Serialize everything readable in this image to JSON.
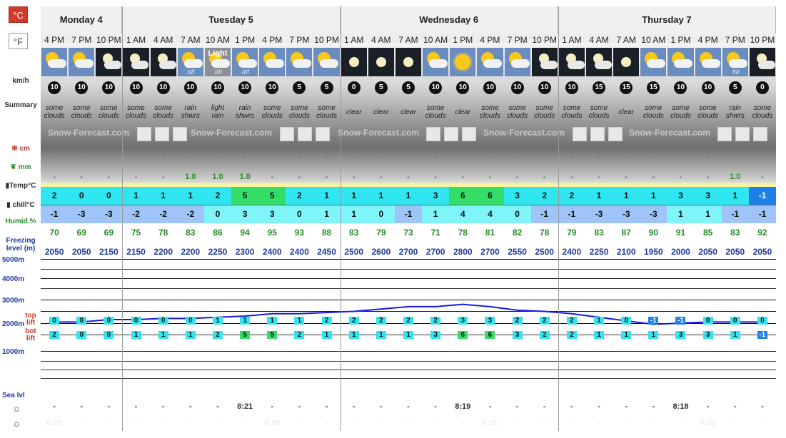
{
  "units": {
    "celsius": "°C",
    "fahrenheit": "°F"
  },
  "labels": {
    "wind": "km/h",
    "summary": "Summary",
    "snow": "cm",
    "rain": "mm",
    "temp": "Temp°C",
    "chill": "chill°C",
    "humid": "Humid.%",
    "freezing1": "Freezing",
    "freezing2": "level (m)",
    "top_lift1": "top",
    "top_lift2": "lift",
    "bot_lift1": "bot",
    "bot_lift2": "lift",
    "sea": "Sea lvl",
    "alt5000": "5000m",
    "alt4000": "4000m",
    "alt3000": "3000m",
    "alt2000": "2000m",
    "alt1000": "1000m"
  },
  "watermark": "Snow-Forecast.com",
  "days": [
    {
      "name": "Monday 4",
      "span": 3
    },
    {
      "name": "Tuesday 5",
      "span": 8
    },
    {
      "name": "Wednesday 6",
      "span": 8
    },
    {
      "name": "Thursday 7",
      "span": 8
    }
  ],
  "times": [
    "4 PM",
    "7 PM",
    "10 PM",
    "1 AM",
    "4 AM",
    "7 AM",
    "10 AM",
    "1 PM",
    "4 PM",
    "7 PM",
    "10 PM",
    "1 AM",
    "4 AM",
    "7 AM",
    "10 AM",
    "1 PM",
    "4 PM",
    "7 PM",
    "10 PM",
    "1 AM",
    "4 AM",
    "7 AM",
    "10 AM",
    "1 PM",
    "4 PM",
    "7 PM",
    "10 PM"
  ],
  "icons": [
    "partly-cloudy-icon",
    "partly-cloudy-icon",
    "cloudy-night-icon",
    "cloudy-night-icon",
    "cloudy-night-icon",
    "rain-showers-icon",
    "light-rain-icon",
    "rain-showers-icon",
    "partly-cloudy-icon",
    "partly-cloudy-icon",
    "partly-cloudy-icon",
    "clear-night-icon",
    "clear-night-icon",
    "clear-night-icon",
    "partly-cloudy-icon",
    "sunny-icon",
    "partly-cloudy-icon",
    "partly-cloudy-icon",
    "cloudy-night-icon",
    "cloudy-night-icon",
    "cloudy-night-icon",
    "clear-night-icon",
    "partly-cloudy-icon",
    "partly-cloudy-icon",
    "partly-cloudy-icon",
    "rain-showers-icon",
    "cloudy-night-icon"
  ],
  "icon_label_light": "Light",
  "wind": [
    "10",
    "10",
    "10",
    "10",
    "10",
    "10",
    "10",
    "10",
    "10",
    "5",
    "5",
    "0",
    "5",
    "5",
    "10",
    "10",
    "10",
    "10",
    "10",
    "10",
    "15",
    "15",
    "15",
    "10",
    "10",
    "5",
    "0"
  ],
  "summary": [
    [
      "some",
      "clouds"
    ],
    [
      "some",
      "clouds"
    ],
    [
      "some",
      "clouds"
    ],
    [
      "some",
      "clouds"
    ],
    [
      "some",
      "clouds"
    ],
    [
      "rain",
      "shwrs"
    ],
    [
      "light",
      "rain"
    ],
    [
      "rain",
      "shwrs"
    ],
    [
      "some",
      "clouds"
    ],
    [
      "some",
      "clouds"
    ],
    [
      "some",
      "clouds"
    ],
    [
      "clear",
      ""
    ],
    [
      "clear",
      ""
    ],
    [
      "clear",
      ""
    ],
    [
      "some",
      "clouds"
    ],
    [
      "clear",
      ""
    ],
    [
      "some",
      "clouds"
    ],
    [
      "some",
      "clouds"
    ],
    [
      "some",
      "clouds"
    ],
    [
      "some",
      "clouds"
    ],
    [
      "some",
      "clouds"
    ],
    [
      "clear",
      ""
    ],
    [
      "some",
      "clouds"
    ],
    [
      "some",
      "clouds"
    ],
    [
      "some",
      "clouds"
    ],
    [
      "rain",
      "shwrs"
    ],
    [
      "some",
      "clouds"
    ]
  ],
  "snow": [
    "-",
    "-",
    "-",
    "-",
    "-",
    "-",
    "-",
    "-",
    "-",
    "-",
    "-",
    "-",
    "-",
    "-",
    "-",
    "-",
    "-",
    "-",
    "-",
    "-",
    "-",
    "-",
    "-",
    "-",
    "-",
    "-",
    "-"
  ],
  "rain": [
    "-",
    "-",
    "-",
    "-",
    "-",
    "1.0",
    "1.0",
    "1.0",
    "-",
    "-",
    "-",
    "-",
    "-",
    "-",
    "-",
    "-",
    "-",
    "-",
    "-",
    "-",
    "-",
    "-",
    "-",
    "-",
    "-",
    "1.0",
    "-"
  ],
  "temp": [
    "2",
    "0",
    "0",
    "1",
    "1",
    "1",
    "2",
    "5",
    "5",
    "2",
    "1",
    "1",
    "1",
    "1",
    "3",
    "6",
    "6",
    "3",
    "2",
    "2",
    "1",
    "1",
    "1",
    "3",
    "3",
    "1",
    "-1"
  ],
  "chill": [
    "-1",
    "-3",
    "-3",
    "-2",
    "-2",
    "-2",
    "0",
    "3",
    "3",
    "0",
    "1",
    "1",
    "0",
    "-1",
    "1",
    "4",
    "4",
    "0",
    "-1",
    "-1",
    "-3",
    "-3",
    "-3",
    "1",
    "1",
    "-1",
    "-1"
  ],
  "humid": [
    "70",
    "69",
    "69",
    "75",
    "78",
    "83",
    "86",
    "94",
    "95",
    "93",
    "88",
    "83",
    "79",
    "73",
    "71",
    "78",
    "81",
    "82",
    "78",
    "79",
    "83",
    "87",
    "90",
    "91",
    "85",
    "83",
    "92"
  ],
  "freezing": [
    "2050",
    "2050",
    "2150",
    "2150",
    "2200",
    "2200",
    "2250",
    "2300",
    "2400",
    "2400",
    "2450",
    "2500",
    "2600",
    "2700",
    "2700",
    "2800",
    "2700",
    "2550",
    "2500",
    "2400",
    "2250",
    "2100",
    "1950",
    "2000",
    "2050",
    "2050",
    "2050"
  ],
  "top_lift": [
    "0",
    "0",
    "0",
    "0",
    "0",
    "0",
    "1",
    "1",
    "1",
    "1",
    "2",
    "2",
    "2",
    "2",
    "2",
    "3",
    "3",
    "2",
    "2",
    "2",
    "1",
    "0",
    "-1",
    "-1",
    "0",
    "0",
    "0"
  ],
  "bot_lift": [
    "2",
    "0",
    "0",
    "1",
    "1",
    "1",
    "2",
    "5",
    "5",
    "2",
    "1",
    "1",
    "1",
    "1",
    "3",
    "6",
    "6",
    "3",
    "2",
    "2",
    "1",
    "1",
    "1",
    "3",
    "3",
    "1",
    "-1"
  ],
  "sunrise": [
    "-",
    "-",
    "-",
    "-",
    "-",
    "-",
    "-",
    "8:21",
    "-",
    "-",
    "-",
    "-",
    "-",
    "-",
    "-",
    "8:19",
    "-",
    "-",
    "-",
    "-",
    "-",
    "-",
    "-",
    "8:18",
    "-",
    "-",
    "-"
  ],
  "sunset": [
    "6:29",
    "-",
    "-",
    "-",
    "-",
    "-",
    "-",
    "-",
    "6:30",
    "-",
    "-",
    "-",
    "-",
    "-",
    "-",
    "-",
    "6:31",
    "-",
    "-",
    "-",
    "-",
    "-",
    "-",
    "-",
    "6:32",
    "-",
    "-"
  ],
  "colors": {
    "accent": "#d33a2c",
    "cyan": "#2ee5f0",
    "lightcyan": "#7ff4f9",
    "green": "#33dd66",
    "blue": "#1e7fe8",
    "paleblue": "#9fc4f7",
    "freezeline": "#1a1adf"
  }
}
